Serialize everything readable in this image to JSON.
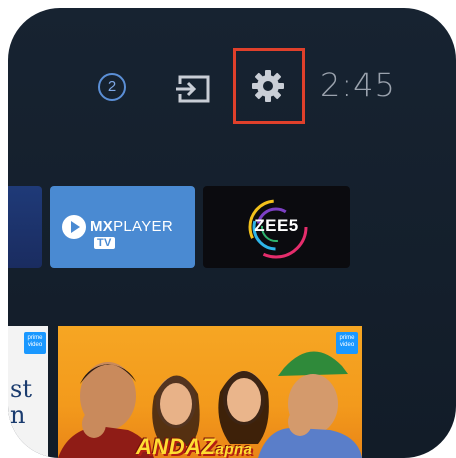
{
  "status_bar": {
    "notification_count": "2",
    "input_icon": "input-source-icon",
    "settings_icon": "gear-icon",
    "time": "2:45"
  },
  "colors": {
    "background": "#152130",
    "highlight": "#e0402b",
    "accent": "#5b8fd6"
  },
  "apps": [
    {
      "name": "partial-app",
      "label": ""
    },
    {
      "name": "mx-player",
      "label_main": "MX",
      "label_rest": "PLAYER",
      "label_tv": "TV"
    },
    {
      "name": "zee5",
      "label": "ZEE5"
    }
  ],
  "content_row": {
    "partial_card": {
      "badge": "prime video",
      "text": "st\nn"
    },
    "poster": {
      "badge": "prime video",
      "title_main": "ANDAZ",
      "title_script": "apna"
    }
  }
}
